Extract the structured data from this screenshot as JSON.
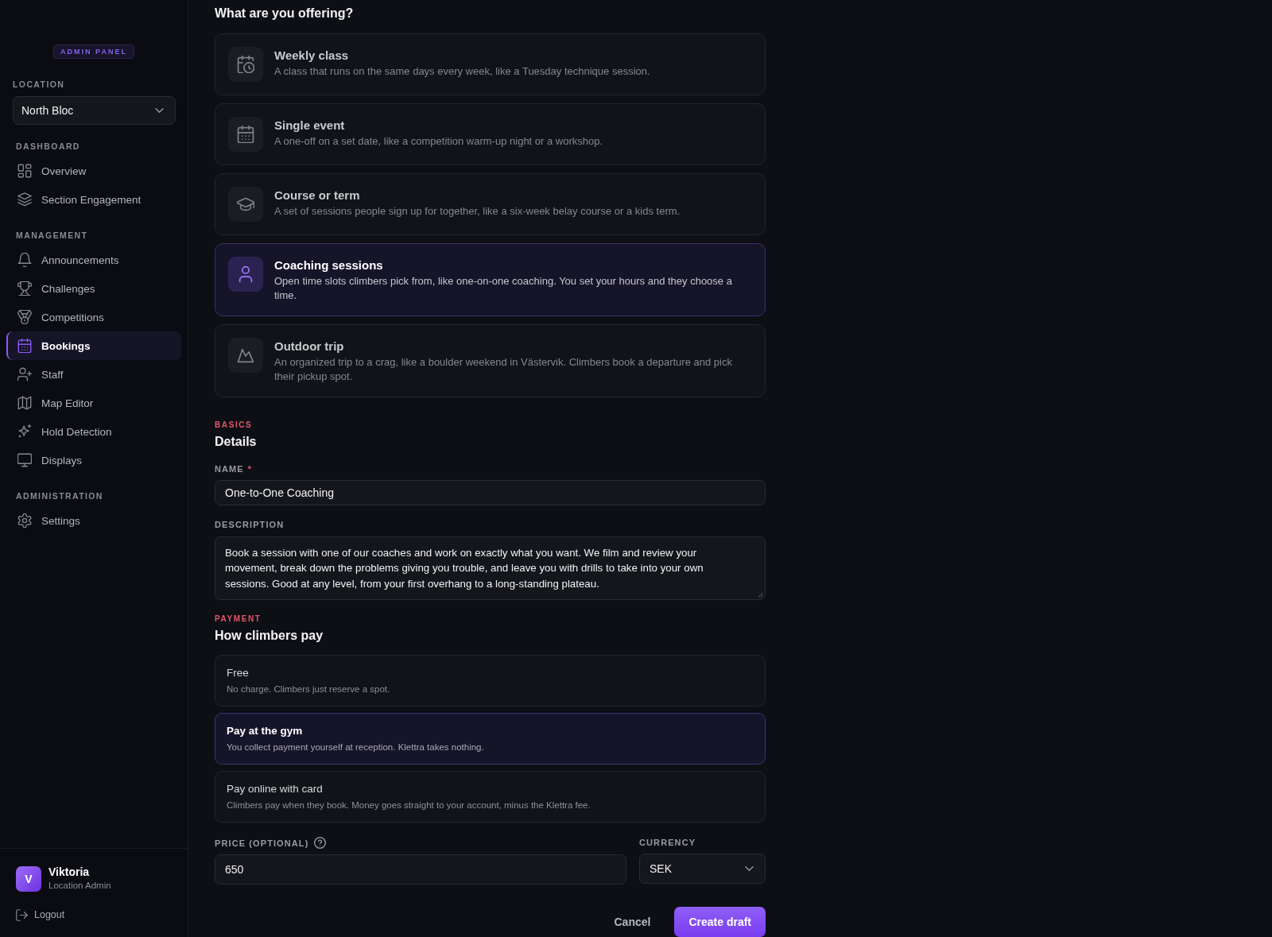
{
  "sidebar": {
    "badge": "ADMIN PANEL",
    "location": {
      "label": "LOCATION",
      "value": "North Bloc"
    },
    "sections": [
      {
        "title": "DASHBOARD",
        "items": [
          {
            "label": "Overview",
            "selected": false
          },
          {
            "label": "Section Engagement",
            "selected": false
          }
        ]
      },
      {
        "title": "MANAGEMENT",
        "items": [
          {
            "label": "Announcements",
            "selected": false
          },
          {
            "label": "Challenges",
            "selected": false
          },
          {
            "label": "Competitions",
            "selected": false
          },
          {
            "label": "Bookings",
            "selected": true
          },
          {
            "label": "Staff",
            "selected": false
          },
          {
            "label": "Map Editor",
            "selected": false
          },
          {
            "label": "Hold Detection",
            "selected": false
          },
          {
            "label": "Displays",
            "selected": false
          }
        ]
      },
      {
        "title": "ADMINISTRATION",
        "items": [
          {
            "label": "Settings",
            "selected": false
          }
        ]
      }
    ],
    "user": {
      "initial": "V",
      "name": "Viktoria",
      "role": "Location Admin"
    },
    "logout": "Logout"
  },
  "offering": {
    "heading": "What are you offering?",
    "options": [
      {
        "title": "Weekly class",
        "description": "A class that runs on the same days every week, like a Tuesday technique session.",
        "selected": false
      },
      {
        "title": "Single event",
        "description": "A one-off on a set date, like a competition warm-up night or a workshop.",
        "selected": false
      },
      {
        "title": "Course or term",
        "description": "A set of sessions people sign up for together, like a six-week belay course or a kids term.",
        "selected": false
      },
      {
        "title": "Coaching sessions",
        "description": "Open time slots climbers pick from, like one-on-one coaching. You set your hours and they choose a time.",
        "selected": true
      },
      {
        "title": "Outdoor trip",
        "description": "An organized trip to a crag, like a boulder weekend in Västervik. Climbers book a departure and pick their pickup spot.",
        "selected": false
      }
    ]
  },
  "details": {
    "eyebrow": "BASICS",
    "heading": "Details",
    "name": {
      "label": "NAME",
      "required_mark": "*",
      "value": "One-to-One Coaching"
    },
    "description": {
      "label": "DESCRIPTION",
      "value": "Book a session with one of our coaches and work on exactly what you want. We film and review your movement, break down the problems giving you trouble, and leave you with drills to take into your own sessions. Good at any level, from your first overhang to a long-standing plateau."
    }
  },
  "payment": {
    "eyebrow": "PAYMENT",
    "heading": "How climbers pay",
    "options": [
      {
        "title": "Free",
        "description": "No charge. Climbers just reserve a spot.",
        "selected": false
      },
      {
        "title": "Pay at the gym",
        "description": "You collect payment yourself at reception. Klettra takes nothing.",
        "selected": true
      },
      {
        "title": "Pay online with card",
        "description": "Climbers pay when they book. Money goes straight to your account, minus the Klettra fee.",
        "selected": false
      }
    ],
    "price": {
      "label": "PRICE (OPTIONAL)",
      "value": "650"
    },
    "currency": {
      "label": "CURRENCY",
      "value": "SEK"
    }
  },
  "actions": {
    "cancel": "Cancel",
    "submit": "Create draft"
  }
}
